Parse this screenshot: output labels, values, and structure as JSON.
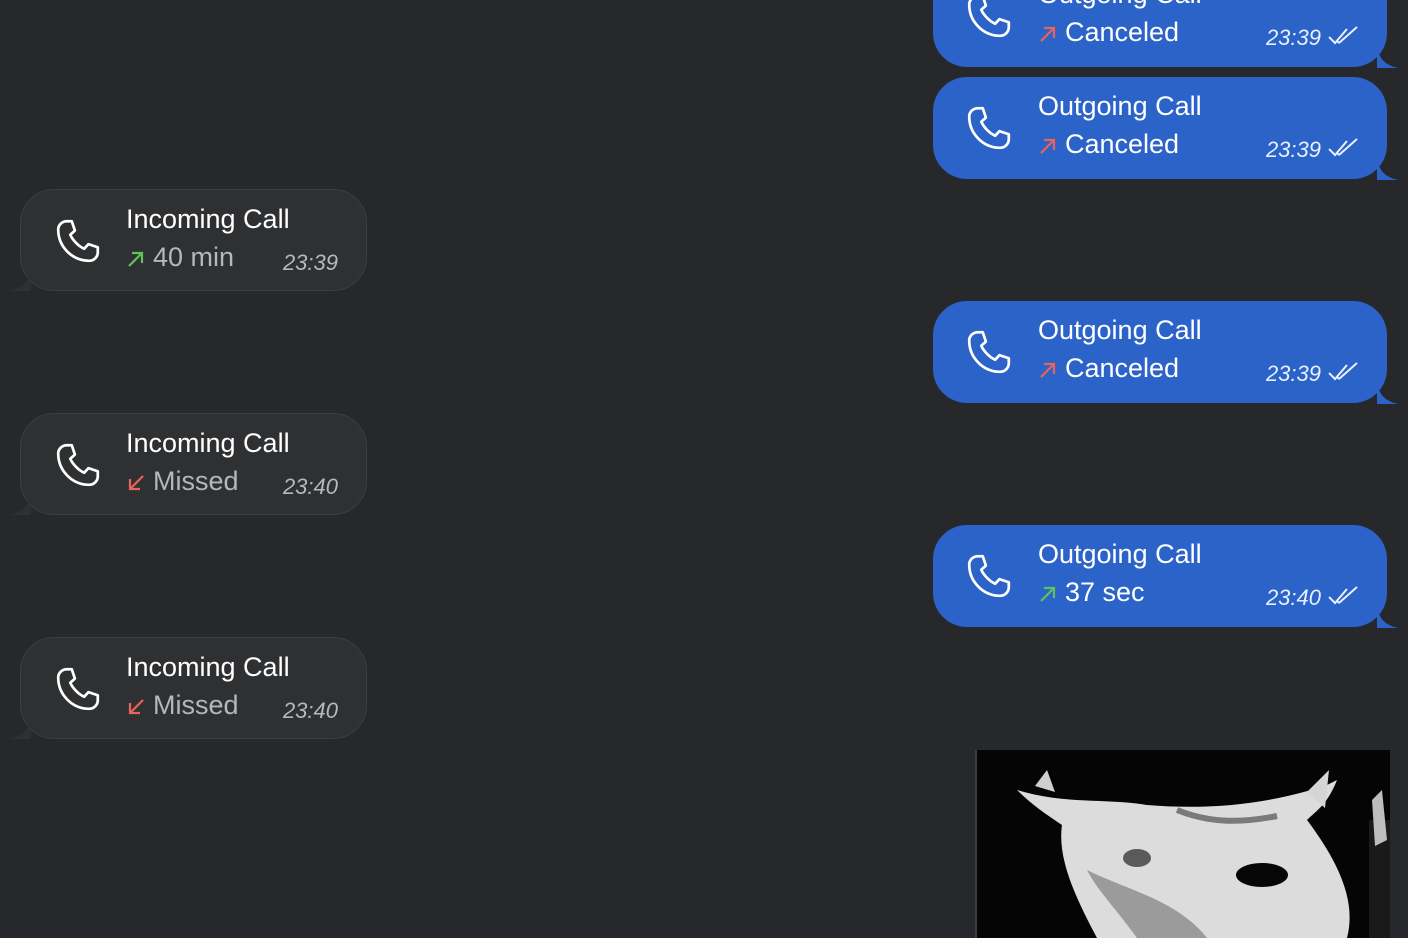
{
  "colors": {
    "background": "#26282b",
    "incoming_bubble": "#2f3032",
    "outgoing_bubble": "#2b63c9",
    "green_arrow": "#5fc25b",
    "red_arrow": "#e8635a"
  },
  "messages": {
    "out_1": {
      "title": "Outgoing Call",
      "status": "Canceled",
      "time": "23:39",
      "arrow": "arrow-up-right-red-icon",
      "read": "double-check-icon"
    },
    "out_2": {
      "title": "Outgoing Call",
      "status": "Canceled",
      "time": "23:39",
      "arrow": "arrow-up-right-red-icon",
      "read": "double-check-icon"
    },
    "in_1": {
      "title": "Incoming Call",
      "status": "40 min",
      "time": "23:39",
      "arrow": "arrow-up-right-green-icon"
    },
    "out_3": {
      "title": "Outgoing Call",
      "status": "Canceled",
      "time": "23:39",
      "arrow": "arrow-up-right-red-icon",
      "read": "double-check-icon"
    },
    "in_2": {
      "title": "Incoming Call",
      "status": "Missed",
      "time": "23:40",
      "arrow": "arrow-down-left-red-icon"
    },
    "out_4": {
      "title": "Outgoing Call",
      "status": "37 sec",
      "time": "23:40",
      "arrow": "arrow-up-right-green-icon",
      "read": "double-check-icon"
    },
    "in_3": {
      "title": "Incoming Call",
      "status": "Missed",
      "time": "23:40",
      "arrow": "arrow-down-left-red-icon"
    }
  },
  "media": {
    "icon": "sticker-image"
  }
}
